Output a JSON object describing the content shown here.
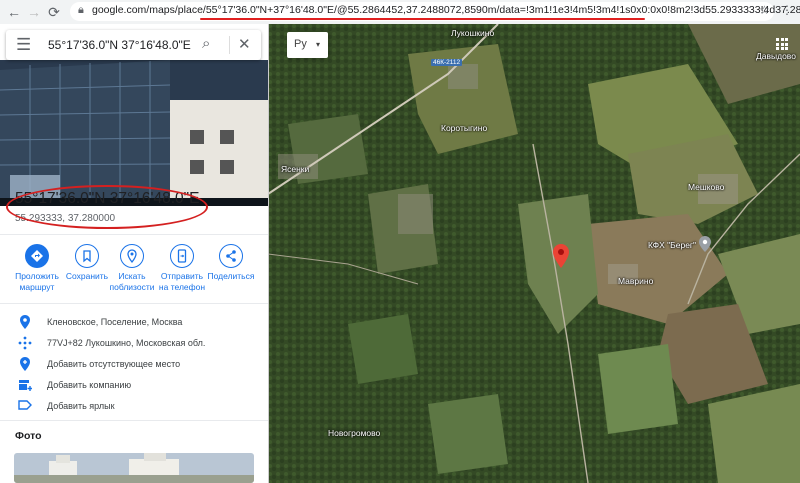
{
  "browser": {
    "url_host": "google.com",
    "url_path": "/maps/place/55°17'36.0\"N+37°16'48.0\"E/@55.2864452,37.2488072,8590m/data=!3m1!1e3!4m5!3m4!1s0x0:0x0!8m2!3d55.2933333!4d37.28",
    "lock_icon": "lock-icon"
  },
  "search": {
    "value": "55°17'36.0\"N 37°16'48.0\"E"
  },
  "map_controls": {
    "layer_label": "Ру"
  },
  "place": {
    "title": "55°17'36.0\"N 37°16'48.0\"E",
    "decimal": "55.293333, 37.280000"
  },
  "actions": [
    {
      "label1": "Проложить",
      "label2": "маршрут",
      "icon": "directions-icon"
    },
    {
      "label1": "Сохранить",
      "label2": "",
      "icon": "bookmark-icon"
    },
    {
      "label1": "Искать",
      "label2": "поблизости",
      "icon": "nearby-icon"
    },
    {
      "label1": "Отправить",
      "label2": "на телефон",
      "icon": "send-to-phone-icon"
    },
    {
      "label1": "Поделиться",
      "label2": "",
      "icon": "share-icon"
    }
  ],
  "info": [
    {
      "text": "Кленовское, Поселение, Москва",
      "icon": "location-pin-icon"
    },
    {
      "text": "77VJ+82 Лукошкино, Московская обл.",
      "icon": "plus-code-icon"
    },
    {
      "text": "Добавить отсутствующее место",
      "icon": "add-place-icon"
    },
    {
      "text": "Добавить компанию",
      "icon": "add-business-icon"
    },
    {
      "text": "Добавить ярлык",
      "icon": "label-icon"
    }
  ],
  "photos_title": "Фото",
  "map_labels": {
    "l1": "Лукошкино",
    "l2": "Коротыгино",
    "l3": "Ясенки",
    "l4": "Мешково",
    "l5": "КФХ \"Берег\"",
    "l6": "Маврино",
    "l7": "Новогромово",
    "l8": "Давыдово",
    "road": "46К-2112"
  },
  "colors": {
    "accent": "#1a73e8",
    "marker": "#ea4335",
    "annotation": "#d42020"
  }
}
